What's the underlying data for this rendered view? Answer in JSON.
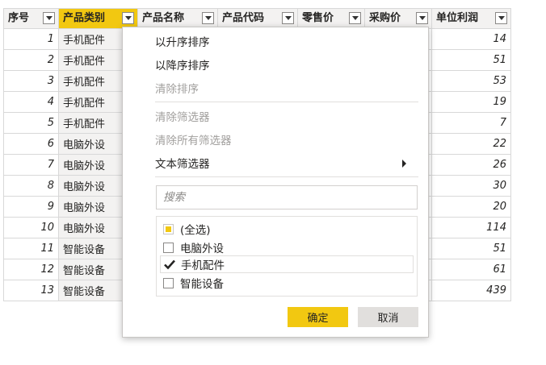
{
  "table": {
    "columns": [
      "序号",
      "产品类别",
      "产品名称",
      "产品代码",
      "零售价",
      "采购价",
      "单位利润"
    ],
    "rows": [
      {
        "index": "1",
        "category": "手机配件",
        "profit": "14"
      },
      {
        "index": "2",
        "category": "手机配件",
        "profit": "51"
      },
      {
        "index": "3",
        "category": "手机配件",
        "profit": "53"
      },
      {
        "index": "4",
        "category": "手机配件",
        "profit": "19"
      },
      {
        "index": "5",
        "category": "手机配件",
        "profit": "7"
      },
      {
        "index": "6",
        "category": "电脑外设",
        "profit": "22"
      },
      {
        "index": "7",
        "category": "电脑外设",
        "profit": "26"
      },
      {
        "index": "8",
        "category": "电脑外设",
        "profit": "30"
      },
      {
        "index": "9",
        "category": "电脑外设",
        "profit": "20"
      },
      {
        "index": "10",
        "category": "电脑外设",
        "profit": "114"
      },
      {
        "index": "11",
        "category": "智能设备",
        "profit": "51"
      },
      {
        "index": "12",
        "category": "智能设备",
        "profit": "61"
      },
      {
        "index": "13",
        "category": "智能设备",
        "profit": "439"
      }
    ]
  },
  "menu": {
    "sort_asc": "以升序排序",
    "sort_desc": "以降序排序",
    "clear_sort": "清除排序",
    "clear_filter": "清除筛选器",
    "clear_all_filters": "清除所有筛选器",
    "text_filter": "文本筛选器",
    "search_placeholder": "搜索",
    "options": [
      {
        "label": "(全选)",
        "state": "partial"
      },
      {
        "label": "电脑外设",
        "state": "unchecked"
      },
      {
        "label": "手机配件",
        "state": "checked"
      },
      {
        "label": "智能设备",
        "state": "unchecked"
      }
    ],
    "ok_label": "确定",
    "cancel_label": "取消",
    "accent_color": "#F2C811"
  }
}
